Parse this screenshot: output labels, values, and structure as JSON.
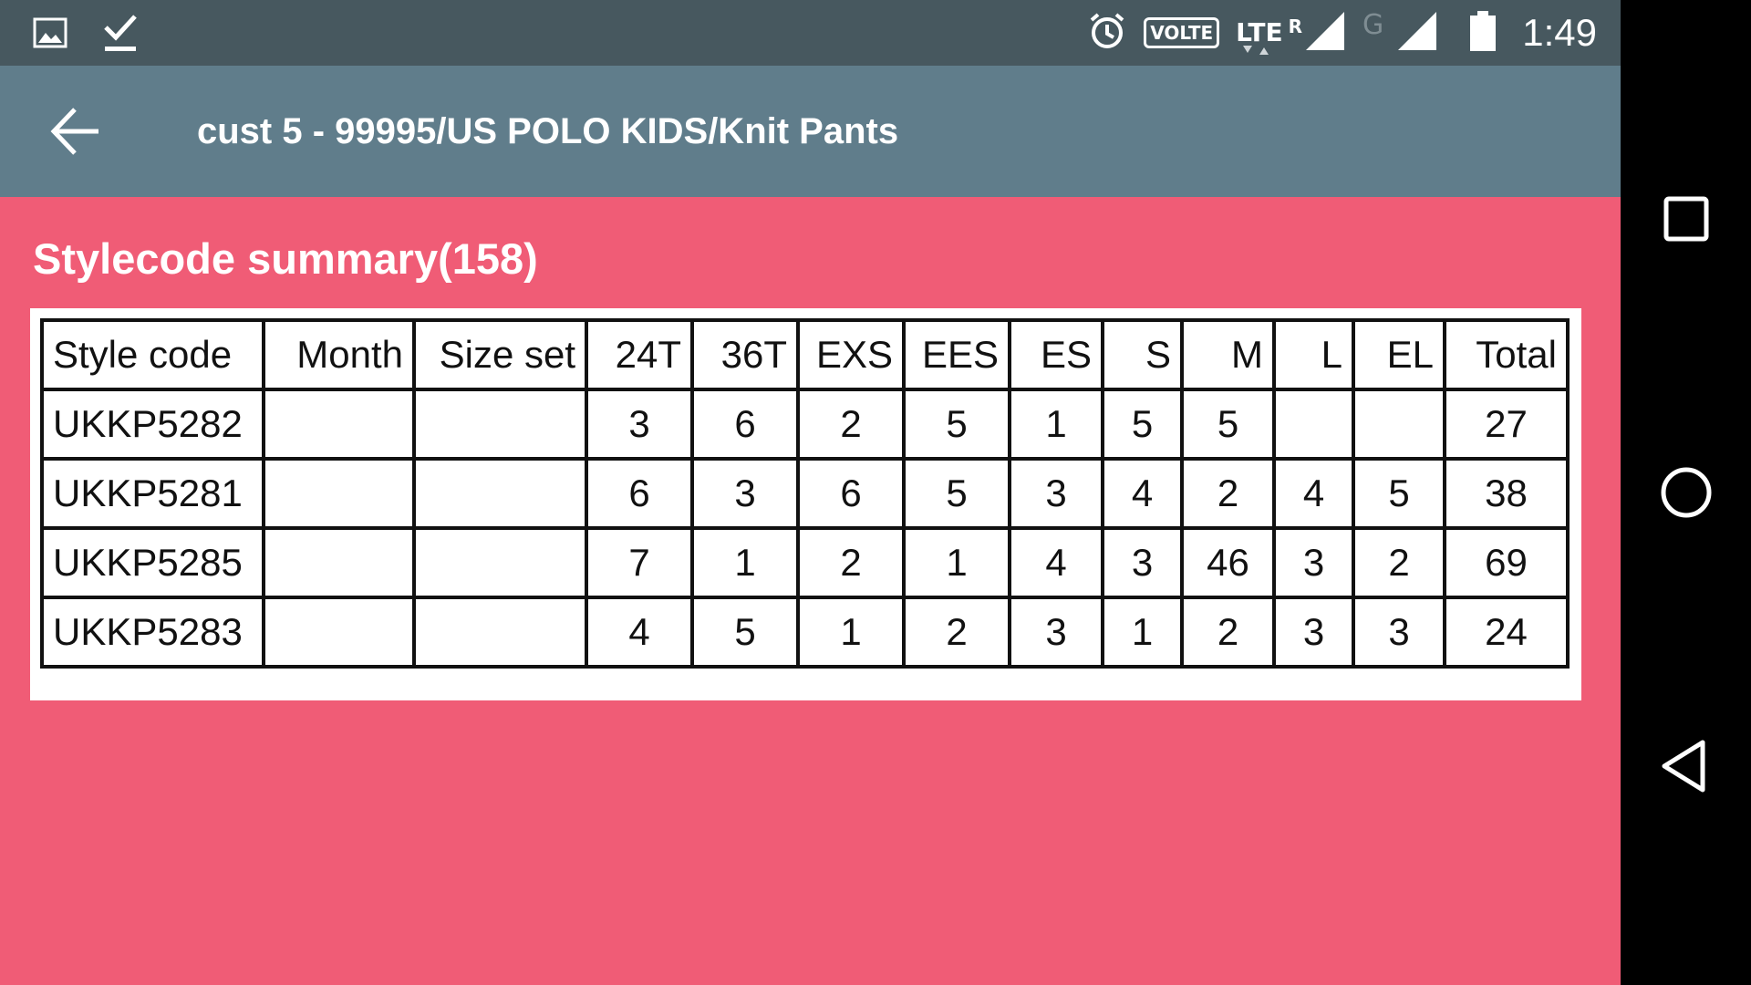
{
  "status_bar": {
    "icons_left": [
      "image-icon",
      "download-done-icon"
    ],
    "volte_label": "VOLTE",
    "lte_label": "LTE",
    "roaming_label": "R",
    "g_label": "G",
    "time": "1:49"
  },
  "app_bar": {
    "title": "cust 5 - 99995/US POLO KIDS/Knit Pants"
  },
  "summary": {
    "title": "Stylecode summary(158)",
    "headers": [
      "Style code",
      "Month",
      "Size set",
      "24T",
      "36T",
      "EXS",
      "EES",
      "ES",
      "S",
      "M",
      "L",
      "EL",
      "Total"
    ],
    "rows": [
      [
        "UKKP5282",
        "",
        "",
        "3",
        "6",
        "2",
        "5",
        "1",
        "5",
        "5",
        "",
        "",
        "27"
      ],
      [
        "UKKP5281",
        "",
        "",
        "6",
        "3",
        "6",
        "5",
        "3",
        "4",
        "2",
        "4",
        "5",
        "38"
      ],
      [
        "UKKP5285",
        "",
        "",
        "7",
        "1",
        "2",
        "1",
        "4",
        "3",
        "46",
        "3",
        "2",
        "69"
      ],
      [
        "UKKP5283",
        "",
        "",
        "4",
        "5",
        "1",
        "2",
        "3",
        "1",
        "2",
        "3",
        "3",
        "24"
      ]
    ]
  },
  "colors": {
    "status_bar": "#47585f",
    "app_bar": "#607d8b",
    "content_bg": "#f05c76",
    "nav_bar": "#000000"
  }
}
